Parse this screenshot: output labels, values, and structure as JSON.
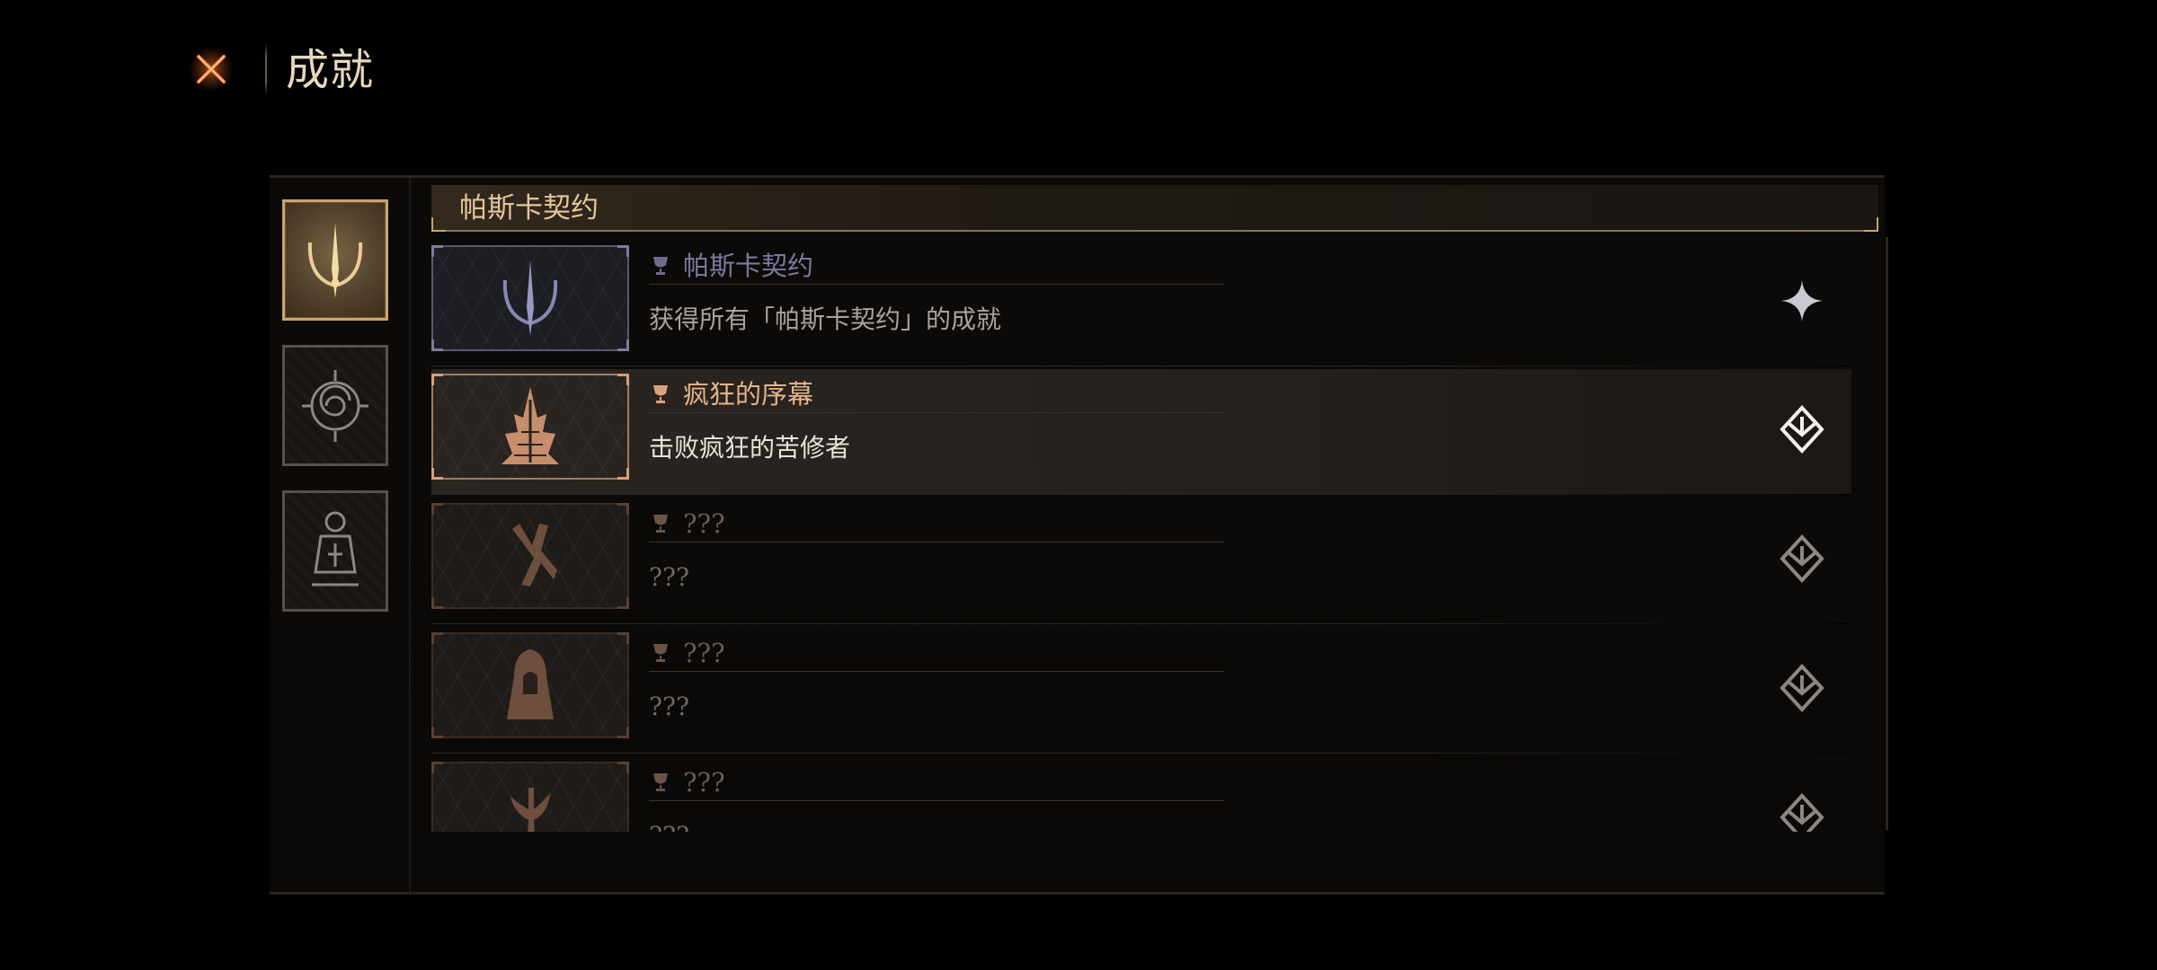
{
  "header": {
    "title": "成就",
    "close_icon": "close-x-icon"
  },
  "tabs": [
    {
      "icon": "pascal-contract-emblem-icon",
      "active": true
    },
    {
      "icon": "spiral-compass-emblem-icon",
      "active": false
    },
    {
      "icon": "lantern-emblem-icon",
      "active": false
    }
  ],
  "section": {
    "title": "帕斯卡契约"
  },
  "achievements": [
    {
      "title": "帕斯卡契约",
      "description": "获得所有「帕斯卡契约」的成就",
      "state": "collection",
      "icon": "pascal-contract-emblem-icon",
      "status_icon": "four-point-star-icon"
    },
    {
      "title": "疯狂的序幕",
      "description": "击败疯狂的苦修者",
      "state": "unlocked",
      "icon": "spiked-tower-icon",
      "status_icon": "unlocked-emblem-icon"
    },
    {
      "title": "???",
      "description": "???",
      "state": "locked",
      "icon": "crossed-blades-icon",
      "status_icon": "locked-emblem-icon"
    },
    {
      "title": "???",
      "description": "???",
      "state": "locked",
      "icon": "hooded-figure-icon",
      "status_icon": "locked-emblem-icon"
    },
    {
      "title": "???",
      "description": "???",
      "state": "locked",
      "icon": "twisted-tree-icon",
      "status_icon": "locked-emblem-icon"
    }
  ],
  "colors": {
    "accent_gold": "#c9a46e",
    "title_collection": "#7c79a0",
    "title_unlocked": "#e3b58a",
    "title_locked": "#6a5a4f",
    "desc_normal": "#a9a39b",
    "desc_unlocked": "#e9e4dc",
    "desc_locked": "#6d6863"
  }
}
